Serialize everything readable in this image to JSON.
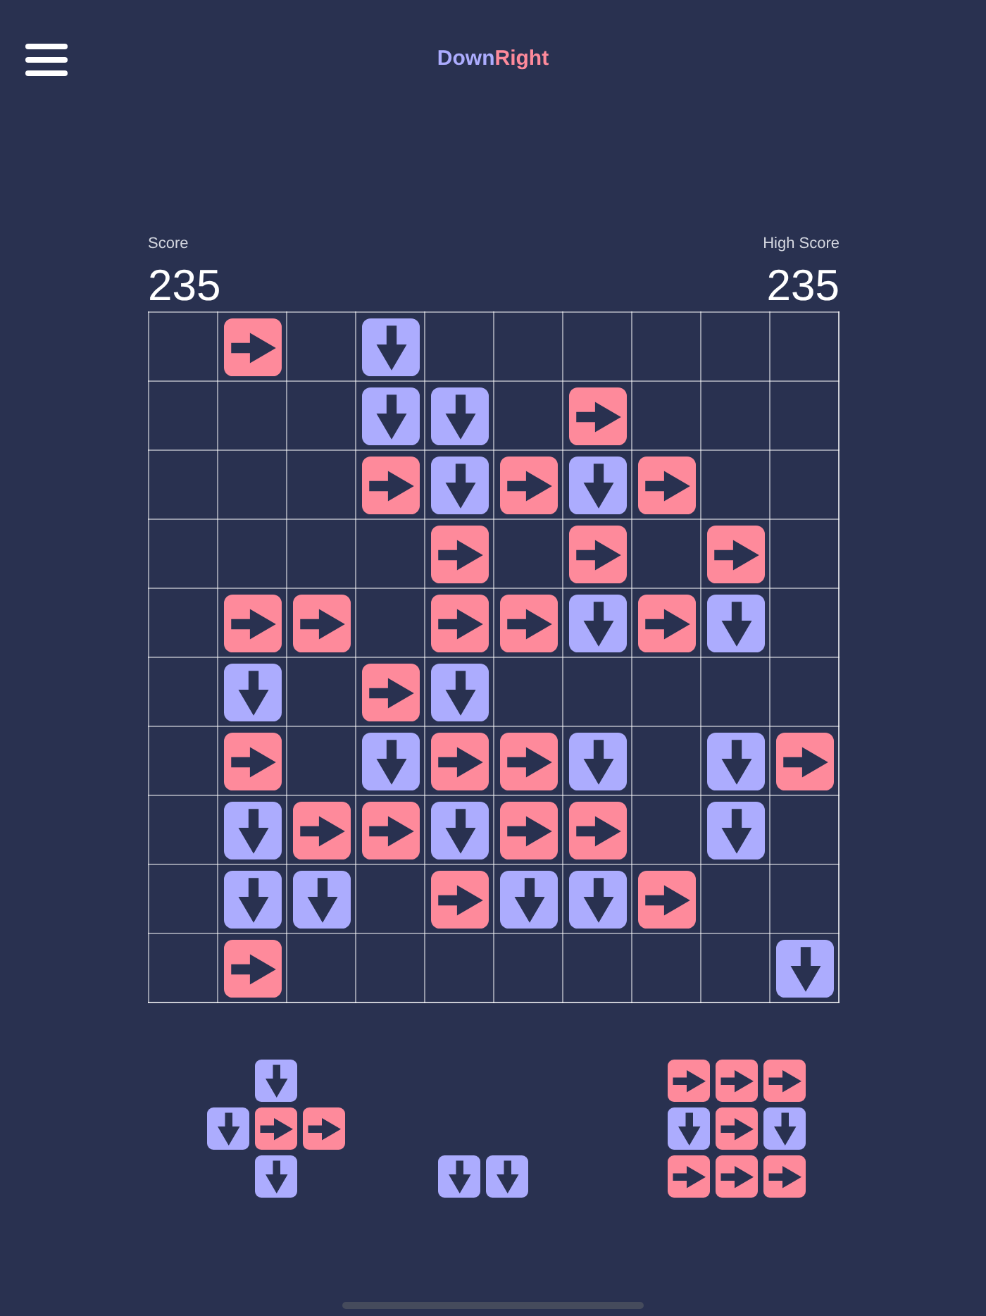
{
  "header": {
    "title": {
      "parts": [
        {
          "text": "Down",
          "kind": "down"
        },
        {
          "text": "Right",
          "kind": "right"
        }
      ]
    }
  },
  "score": {
    "label": "Score",
    "value": "235"
  },
  "high_score": {
    "label": "High Score",
    "value": "235"
  },
  "board": {
    "rows": [
      [
        {
          "kind": "empty"
        },
        {
          "kind": "right"
        },
        {
          "kind": "empty"
        },
        {
          "kind": "down"
        },
        {
          "kind": "empty"
        },
        {
          "kind": "empty"
        },
        {
          "kind": "empty"
        },
        {
          "kind": "empty"
        },
        {
          "kind": "empty"
        },
        {
          "kind": "empty"
        }
      ],
      [
        {
          "kind": "empty"
        },
        {
          "kind": "empty"
        },
        {
          "kind": "empty"
        },
        {
          "kind": "down"
        },
        {
          "kind": "down"
        },
        {
          "kind": "empty"
        },
        {
          "kind": "right"
        },
        {
          "kind": "empty"
        },
        {
          "kind": "empty"
        },
        {
          "kind": "empty"
        }
      ],
      [
        {
          "kind": "empty"
        },
        {
          "kind": "empty"
        },
        {
          "kind": "empty"
        },
        {
          "kind": "right"
        },
        {
          "kind": "down"
        },
        {
          "kind": "right"
        },
        {
          "kind": "down"
        },
        {
          "kind": "right"
        },
        {
          "kind": "empty"
        },
        {
          "kind": "empty"
        }
      ],
      [
        {
          "kind": "empty"
        },
        {
          "kind": "empty"
        },
        {
          "kind": "empty"
        },
        {
          "kind": "empty"
        },
        {
          "kind": "right"
        },
        {
          "kind": "empty"
        },
        {
          "kind": "right"
        },
        {
          "kind": "empty"
        },
        {
          "kind": "right"
        },
        {
          "kind": "empty"
        }
      ],
      [
        {
          "kind": "empty"
        },
        {
          "kind": "right"
        },
        {
          "kind": "right"
        },
        {
          "kind": "empty"
        },
        {
          "kind": "right"
        },
        {
          "kind": "right"
        },
        {
          "kind": "down"
        },
        {
          "kind": "right"
        },
        {
          "kind": "down"
        },
        {
          "kind": "empty"
        }
      ],
      [
        {
          "kind": "empty"
        },
        {
          "kind": "down"
        },
        {
          "kind": "empty"
        },
        {
          "kind": "right"
        },
        {
          "kind": "down"
        },
        {
          "kind": "empty"
        },
        {
          "kind": "empty"
        },
        {
          "kind": "empty"
        },
        {
          "kind": "empty"
        },
        {
          "kind": "empty"
        }
      ],
      [
        {
          "kind": "empty"
        },
        {
          "kind": "right"
        },
        {
          "kind": "empty"
        },
        {
          "kind": "down"
        },
        {
          "kind": "right"
        },
        {
          "kind": "right"
        },
        {
          "kind": "down"
        },
        {
          "kind": "empty"
        },
        {
          "kind": "down"
        },
        {
          "kind": "right"
        }
      ],
      [
        {
          "kind": "empty"
        },
        {
          "kind": "down"
        },
        {
          "kind": "right"
        },
        {
          "kind": "right"
        },
        {
          "kind": "down"
        },
        {
          "kind": "right"
        },
        {
          "kind": "right"
        },
        {
          "kind": "empty"
        },
        {
          "kind": "down"
        },
        {
          "kind": "empty"
        }
      ],
      [
        {
          "kind": "empty"
        },
        {
          "kind": "down"
        },
        {
          "kind": "down"
        },
        {
          "kind": "empty"
        },
        {
          "kind": "right"
        },
        {
          "kind": "down"
        },
        {
          "kind": "down"
        },
        {
          "kind": "right"
        },
        {
          "kind": "empty"
        },
        {
          "kind": "empty"
        }
      ],
      [
        {
          "kind": "empty"
        },
        {
          "kind": "right"
        },
        {
          "kind": "empty"
        },
        {
          "kind": "empty"
        },
        {
          "kind": "empty"
        },
        {
          "kind": "empty"
        },
        {
          "kind": "empty"
        },
        {
          "kind": "empty"
        },
        {
          "kind": "empty"
        },
        {
          "kind": "down"
        }
      ]
    ]
  },
  "tray": {
    "pieces": [
      {
        "rows": [
          [
            {
              "kind": "empty"
            },
            {
              "kind": "down"
            },
            {
              "kind": "empty"
            }
          ],
          [
            {
              "kind": "down"
            },
            {
              "kind": "right"
            },
            {
              "kind": "right"
            }
          ],
          [
            {
              "kind": "empty"
            },
            {
              "kind": "down"
            },
            {
              "kind": "empty"
            }
          ]
        ]
      },
      {
        "rows": [
          [
            {
              "kind": "down"
            },
            {
              "kind": "down"
            }
          ]
        ]
      },
      {
        "rows": [
          [
            {
              "kind": "right"
            },
            {
              "kind": "right"
            },
            {
              "kind": "right"
            }
          ],
          [
            {
              "kind": "down"
            },
            {
              "kind": "right"
            },
            {
              "kind": "down"
            }
          ],
          [
            {
              "kind": "right"
            },
            {
              "kind": "right"
            },
            {
              "kind": "right"
            }
          ]
        ]
      }
    ]
  }
}
